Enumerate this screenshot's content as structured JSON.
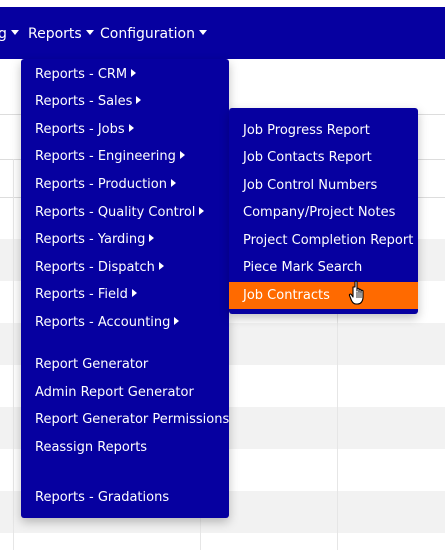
{
  "nav": {
    "items": [
      {
        "label": "g"
      },
      {
        "label": "Reports"
      },
      {
        "label": "Configuration"
      }
    ]
  },
  "reports_menu": {
    "items": [
      {
        "label": "Reports - CRM"
      },
      {
        "label": "Reports - Sales"
      },
      {
        "label": "Reports - Jobs"
      },
      {
        "label": "Reports - Engineering"
      },
      {
        "label": "Reports - Production"
      },
      {
        "label": "Reports - Quality Control"
      },
      {
        "label": "Reports - Yarding"
      },
      {
        "label": "Reports - Dispatch"
      },
      {
        "label": "Reports - Field"
      },
      {
        "label": "Reports - Accounting"
      },
      {
        "label": "Report Generator"
      },
      {
        "label": "Admin Report Generator"
      },
      {
        "label": "Report Generator Permissions"
      },
      {
        "label": "Reassign Reports"
      },
      {
        "label": "Reports - Gradations"
      }
    ]
  },
  "jobs_submenu": {
    "items": [
      {
        "label": "Job Progress Report"
      },
      {
        "label": "Job Contacts Report"
      },
      {
        "label": "Job Control Numbers"
      },
      {
        "label": "Company/Project Notes"
      },
      {
        "label": "Project Completion Report"
      },
      {
        "label": "Piece Mark Search"
      },
      {
        "label": "Job Contracts"
      }
    ],
    "highlighted": "Job Contracts"
  },
  "colors": {
    "brand": "#0600a0",
    "highlight": "#ff6a00",
    "text": "#ffffff"
  }
}
